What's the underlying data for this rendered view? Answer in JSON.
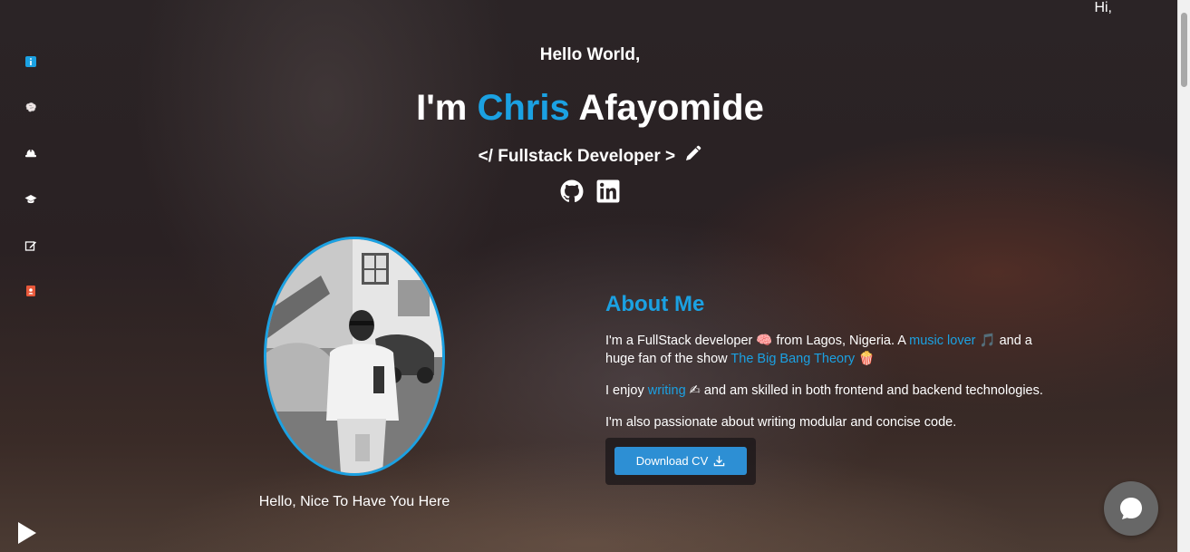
{
  "header": {
    "hi": "Hi,",
    "greeting": "Hello World,",
    "name_prefix": "I'm ",
    "first_name": "Chris",
    "last_name": " Afayomide",
    "role": "</ Fullstack Developer >"
  },
  "sidebar": {
    "items": [
      {
        "icon": "info-icon"
      },
      {
        "icon": "brain-icon"
      },
      {
        "icon": "hardhat-icon"
      },
      {
        "icon": "graduation-cap-icon"
      },
      {
        "icon": "edit-icon"
      },
      {
        "icon": "contact-book-icon"
      }
    ]
  },
  "socials": [
    {
      "icon": "github-icon"
    },
    {
      "icon": "linkedin-icon"
    }
  ],
  "portrait": {
    "caption": "Hello, Nice To Have You Here"
  },
  "about": {
    "title": "About Me",
    "p1_a": "I'm a FullStack developer 🧠 from Lagos, Nigeria. A ",
    "p1_link1": "music lover",
    "p1_b": " 🎵 and a huge fan of the show ",
    "p1_link2": "The Big Bang Theory",
    "p1_c": " 🍿",
    "p2_a": "I enjoy ",
    "p2_link": "writing",
    "p2_b": " ✍ and am skilled in both frontend and backend technologies.",
    "p3": "I'm also passionate about writing modular and concise code.",
    "cv_button": "Download CV"
  },
  "colors": {
    "accent": "#1ba1e2",
    "button": "#2d8fd4",
    "chat_bubble": "#676767"
  }
}
